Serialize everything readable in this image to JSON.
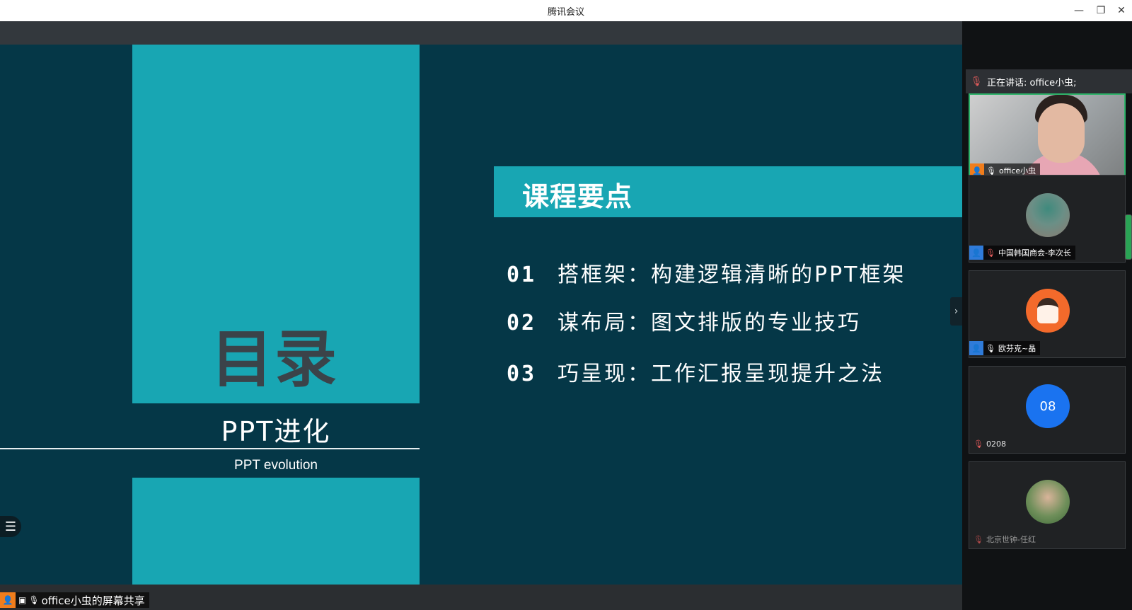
{
  "window": {
    "title": "腾讯会议",
    "controls": {
      "minimize": "—",
      "restore": "❐",
      "close": "✕"
    }
  },
  "slide": {
    "mulu": "目录",
    "ppt_title": "PPT进化",
    "ppt_sub": "PPT evolution",
    "banner": "课程要点",
    "items": [
      {
        "num": "01",
        "text": "搭框架：构建逻辑清晰的PPT框架"
      },
      {
        "num": "02",
        "text": "谋布局：图文排版的专业技巧"
      },
      {
        "num": "03",
        "text": "巧呈现：工作汇报呈现提升之法"
      }
    ],
    "menu_icon": "☰",
    "next_icon": "›",
    "colors": {
      "bg": "#053747",
      "accent": "#18a6b3"
    }
  },
  "share": {
    "label": "office小虫的屏幕共享"
  },
  "sidebar": {
    "speaking": "正在讲话: office小虫;",
    "participants": [
      {
        "name": "office小虫",
        "mic": "on",
        "badge": "orange"
      },
      {
        "name": "中国韩国商会-李次长",
        "mic": "muted",
        "badge": "blue"
      },
      {
        "name": "欧芬克~晶",
        "mic": "on",
        "badge": "blue"
      },
      {
        "name": "0208",
        "mic": "muted",
        "avatar_text": "08"
      },
      {
        "name": "北京世钟-任红",
        "mic": "muted"
      }
    ]
  }
}
